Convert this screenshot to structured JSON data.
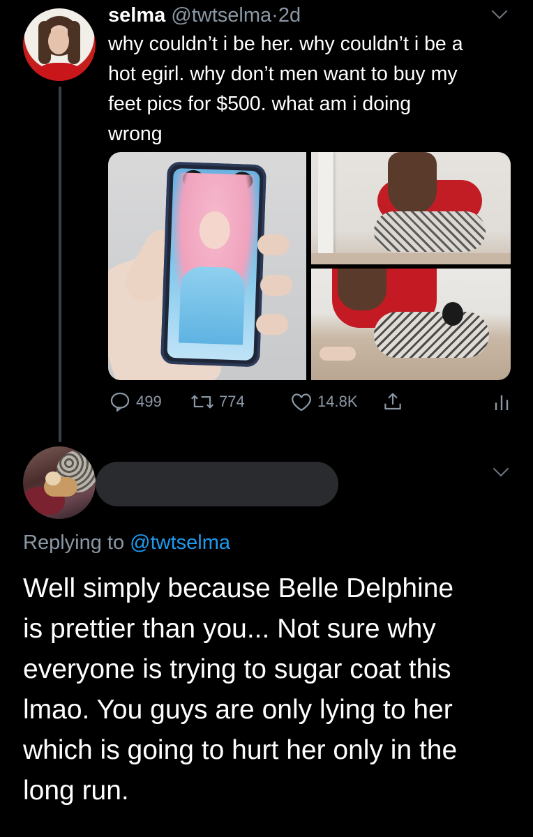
{
  "tweet": {
    "author_name": "selma",
    "author_handle": "@twtselma",
    "separator": "·",
    "age": "2d",
    "text_lines": [
      "why couldn’t i be her. why couldn’t i be a",
      "hot egirl. why don’t men want to buy my",
      "feet pics for $500. what am i doing",
      "wrong"
    ],
    "stats": {
      "replies": "499",
      "retweets": "774",
      "likes": "14.8K"
    }
  },
  "reply": {
    "replying_label": "Replying to",
    "replying_handle": "@twtselma",
    "text_lines": [
      "Well simply because Belle Delphine",
      "is prettier than you... Not sure why",
      "everyone is trying to sugar coat this",
      "lmao. You guys are only lying to her",
      "which is going to hurt her only in the",
      "long run."
    ]
  },
  "colors": {
    "background": "#000000",
    "muted_text": "#8b98a5",
    "link": "#1d9bf0",
    "thread_line": "#3b4046"
  },
  "icons": {
    "reply": "speech-bubble-icon",
    "retweet": "retweet-arrows-icon",
    "like": "heart-icon",
    "share": "share-arrow-icon",
    "analytics": "bar-chart-icon",
    "more": "chevron-down-icon"
  }
}
